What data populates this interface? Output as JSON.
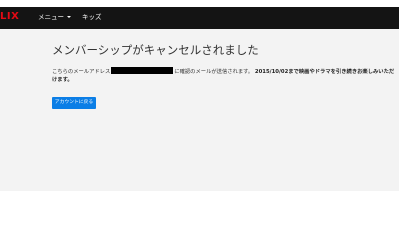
{
  "header": {
    "logo_text": "LIX",
    "menu_label": "メニュー",
    "kids_label": "キッズ",
    "colors": {
      "background": "#141414",
      "logo": "#e50914"
    }
  },
  "main": {
    "title": "メンバーシップがキャンセルされました",
    "message": {
      "before_email": "こちらのメールアドレス",
      "after_email": "に確認のメールが送信されます。",
      "emphasis": "2015/10/02まで映画やドラマを引き続きお楽しみいただけます。"
    },
    "account_button_label": "アカウントに戻る",
    "colors": {
      "button": "#0b7ee6",
      "page_background": "#f3f3f3"
    }
  }
}
